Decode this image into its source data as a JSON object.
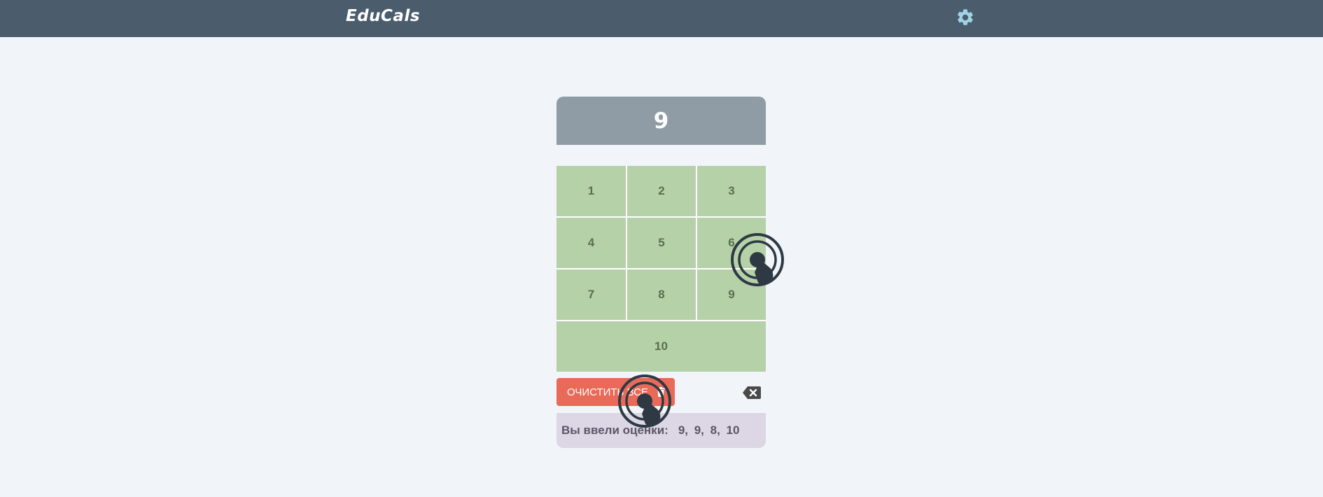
{
  "header": {
    "logo": "EduCals",
    "settings_icon": "gear-icon"
  },
  "calculator": {
    "display_value": "9",
    "keys": [
      "1",
      "2",
      "3",
      "4",
      "5",
      "6",
      "7",
      "8",
      "9",
      "10"
    ],
    "clear_label": "ОЧИСТИТЬ ВСЕ",
    "clear_icon": "trash-icon",
    "backspace_icon": "backspace-icon",
    "entered_label": "Вы ввели оценки:",
    "entered_values": "9, 9, 8, 10"
  },
  "overlay": {
    "tap_icon": "tap-gesture-icon"
  },
  "colors": {
    "topbar": "#4b5c6d",
    "display": "#8f9ba5",
    "keys": "#b5d1a7",
    "clear_button": "#e96a58",
    "entered_panel": "#dcd6e5",
    "gear": "#9fd3e6"
  }
}
